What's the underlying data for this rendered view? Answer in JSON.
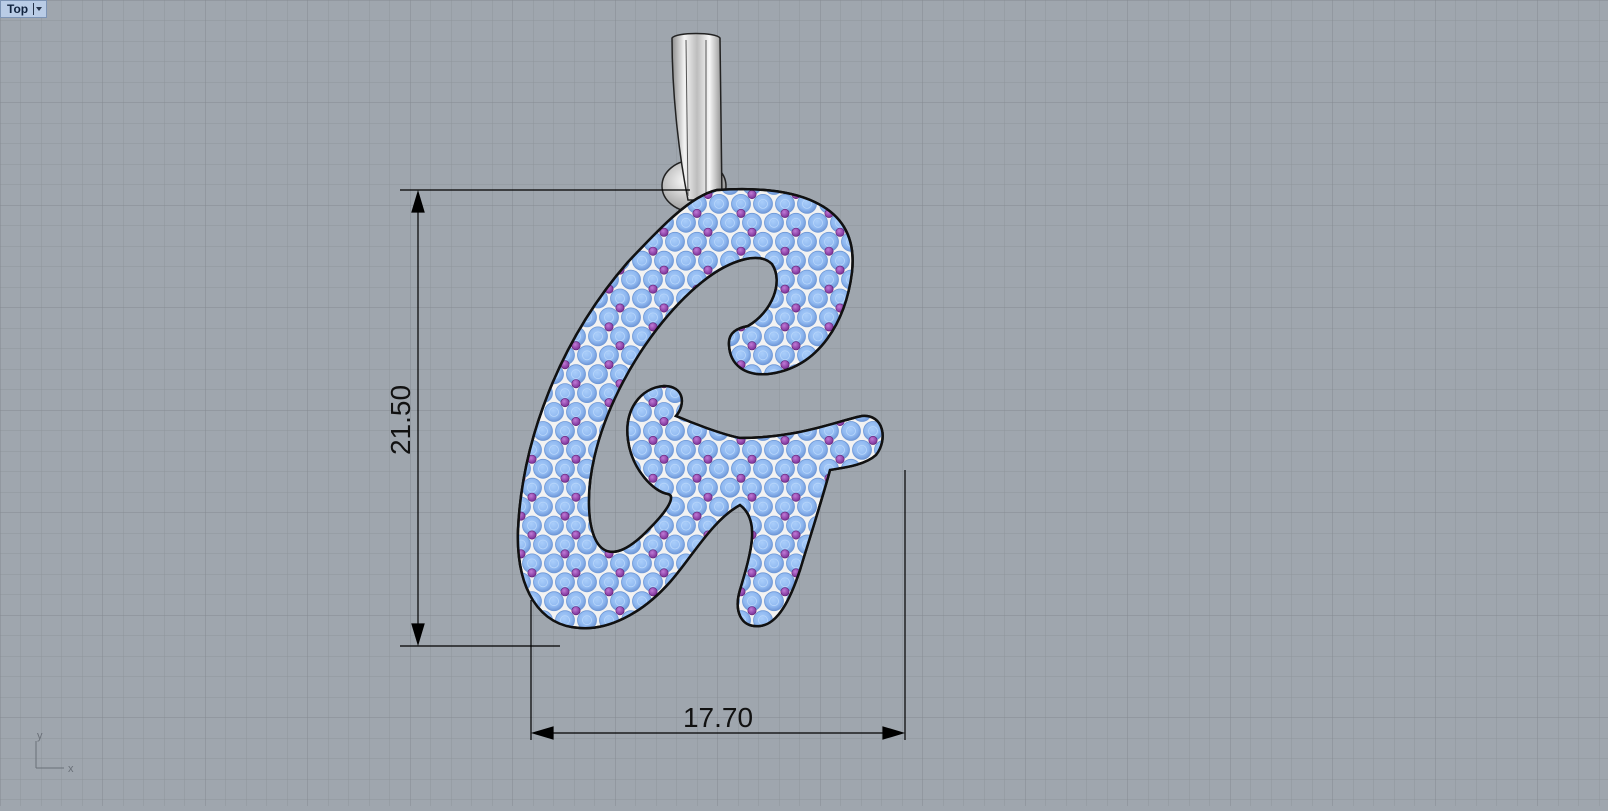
{
  "viewport": {
    "name": "Top",
    "view": "top",
    "background_color": "#9fa6ae",
    "grid_color": "#8f959c",
    "grid_major_color": "#848a91"
  },
  "model": {
    "object": "letter G pendant with bail",
    "metal_color": "#f2f2f2",
    "outline_color": "#111111",
    "stone_primary_color": "#8fb8f0",
    "stone_secondary_color": "#9a44b0"
  },
  "dimensions": {
    "height_label": "21.50",
    "width_label": "17.70",
    "height_value": 21.5,
    "width_value": 17.7,
    "line_color": "#000000"
  },
  "axis_icon": {
    "x_label": "x",
    "y_label": "y"
  }
}
